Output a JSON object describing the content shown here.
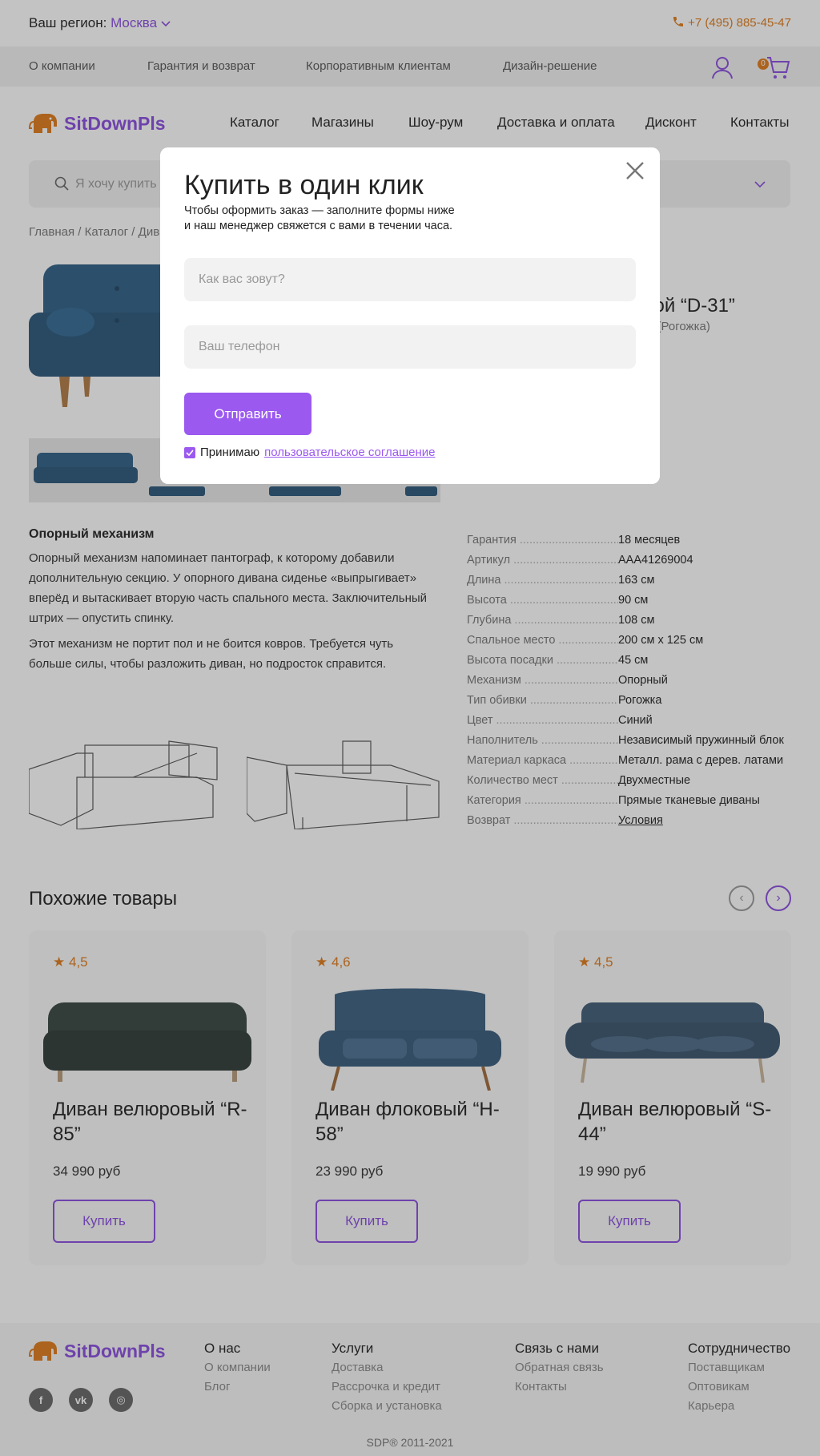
{
  "region": {
    "label": "Ваш регион:",
    "city": "Москва"
  },
  "phone": "+7 (495) 885-45-47",
  "subnav": [
    "О компании",
    "Гарантия и возврат",
    "Корпоративным клиентам",
    "Дизайн-решение"
  ],
  "cart_count": "0",
  "brand": "SitDownPls",
  "mainnav": [
    "Каталог",
    "Магазины",
    "Шоу-рум",
    "Доставка и оплата",
    "Дисконт",
    "Контакты"
  ],
  "search_placeholder": "Я хочу купить",
  "breadcrumbs": [
    "Главная",
    "Каталог",
    "Див"
  ],
  "product": {
    "title_tail": "мой “D-31”",
    "subtitle_tail": "й (Рогожка)"
  },
  "mechanism": {
    "heading": "Опорный механизм",
    "p1": "Опорный механизм напоминает пантограф, к которому добавили дополнительную секцию. У опорного дивана сиденье «выпрыгивает» вперёд и вытаскивает вторую часть спального места. Заключительный штрих — опустить спинку.",
    "p2": "Этот механизм не портит пол и не боится ковров. Требуется чуть больше силы, чтобы разложить диван, но подросток справится."
  },
  "specs": [
    {
      "k": "Гарантия",
      "v": "18 месяцев"
    },
    {
      "k": "Артикул",
      "v": "AAA41269004"
    },
    {
      "k": "Длина",
      "v": "163 см"
    },
    {
      "k": "Высота",
      "v": "90 см"
    },
    {
      "k": "Глубина",
      "v": "108 см"
    },
    {
      "k": "Спальное место",
      "v": "200 см x 125 см"
    },
    {
      "k": "Высота посадки",
      "v": "45 см"
    },
    {
      "k": "Механизм",
      "v": "Опорный"
    },
    {
      "k": "Тип обивки",
      "v": "Рогожка"
    },
    {
      "k": "Цвет",
      "v": "Синий"
    },
    {
      "k": "Наполнитель",
      "v": "Независимый пружинный блок"
    },
    {
      "k": "Материал каркаса",
      "v": "Металл. рама с дерев. латами"
    },
    {
      "k": "Количество мест",
      "v": "Двухместные"
    },
    {
      "k": "Категория",
      "v": "Прямые тканевые диваны"
    },
    {
      "k": "Возврат",
      "v": "Условия"
    }
  ],
  "similar": {
    "heading": "Похожие товары",
    "items": [
      {
        "rating": "4,5",
        "name": "Диван велюровый “R-85”",
        "price": "34 990 руб",
        "buy": "Купить"
      },
      {
        "rating": "4,6",
        "name": "Диван флоковый “H-58”",
        "price": "23 990 руб",
        "buy": "Купить"
      },
      {
        "rating": "4,5",
        "name": "Диван велюровый “S-44”",
        "price": "19 990 руб",
        "buy": "Купить"
      }
    ]
  },
  "footer": {
    "cols": [
      {
        "h": "О нас",
        "items": [
          "О компании",
          "Блог"
        ]
      },
      {
        "h": "Услуги",
        "items": [
          "Доставка",
          "Рассрочка и кредит",
          "Сборка и установка"
        ]
      },
      {
        "h": "Связь с нами",
        "items": [
          "Обратная связь",
          "Контакты"
        ]
      },
      {
        "h": "Сотрудничество",
        "items": [
          "Поставщикам",
          "Оптовикам",
          "Карьера"
        ]
      }
    ],
    "copyright": "SDP®   2011-2021"
  },
  "modal": {
    "title": "Купить в один клик",
    "desc_line1": "Чтобы оформить заказ — заполните формы ниже",
    "desc_line2": "и наш менеджер свяжется с вами в течении часа.",
    "name_placeholder": "Как вас зовут?",
    "phone_placeholder": "Ваш телефон",
    "submit": "Отправить",
    "agree_text": "Принимаю",
    "agree_link": "пользовательское соглашение"
  },
  "colors": {
    "accent": "#9b59f0",
    "orange": "#e07b1a"
  }
}
